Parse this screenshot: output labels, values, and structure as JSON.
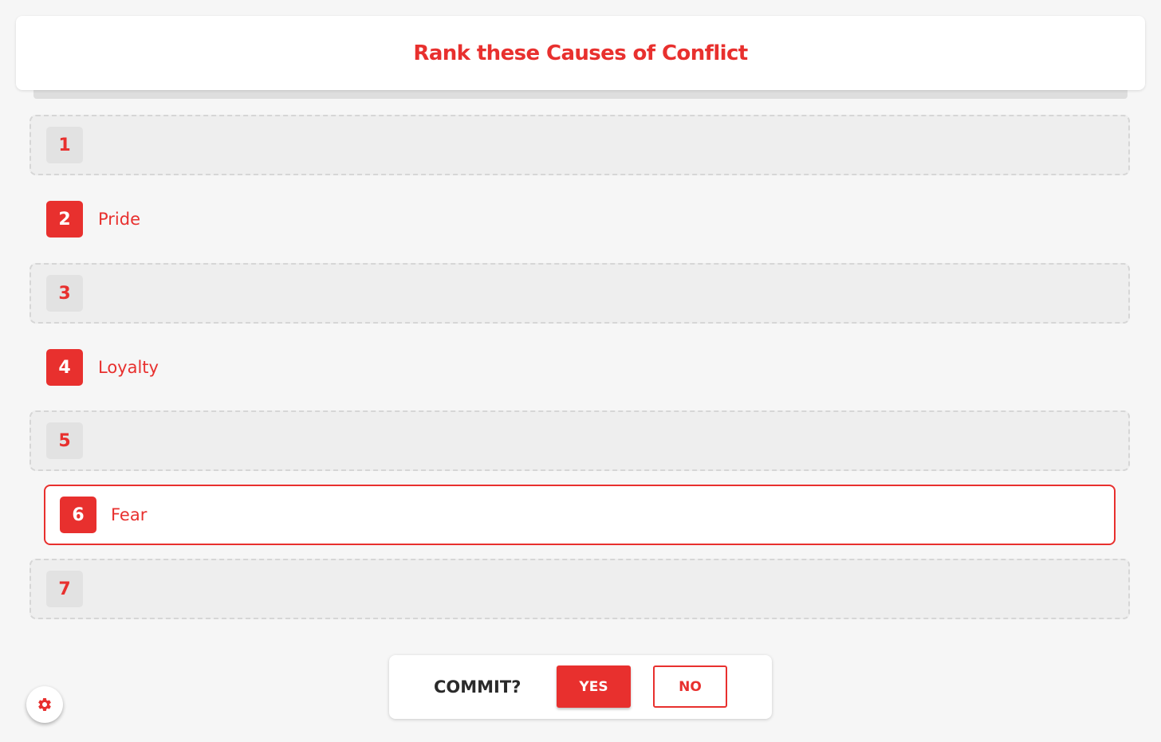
{
  "header": {
    "title": "Rank these Causes of Conflict"
  },
  "ranking": {
    "slots": [
      {
        "rank": "1",
        "label": "",
        "state": "empty"
      },
      {
        "rank": "2",
        "label": "Pride",
        "state": "filled"
      },
      {
        "rank": "3",
        "label": "",
        "state": "empty"
      },
      {
        "rank": "4",
        "label": "Loyalty",
        "state": "filled"
      },
      {
        "rank": "5",
        "label": "",
        "state": "empty"
      },
      {
        "rank": "6",
        "label": "Fear",
        "state": "selected"
      },
      {
        "rank": "7",
        "label": "",
        "state": "empty"
      }
    ]
  },
  "commit": {
    "label": "COMMIT?",
    "yes_label": "YES",
    "no_label": "NO"
  },
  "settings": {
    "icon": "gear-icon"
  },
  "colors": {
    "accent": "#e8302e",
    "background": "#f6f6f6",
    "empty_slot": "#eeeeee",
    "text_dark": "#2a2a2a"
  }
}
